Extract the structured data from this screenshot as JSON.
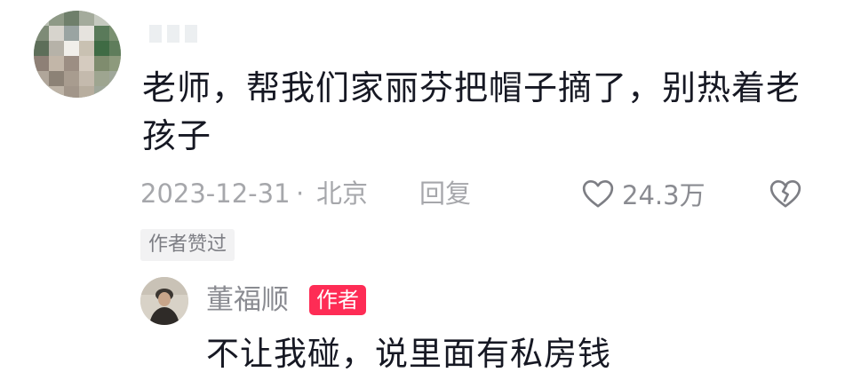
{
  "comment": {
    "text": "老师，帮我们家丽芬把帽子摘了，别热着老孩子",
    "date": "2023-12-31",
    "separator": "·",
    "location": "北京",
    "reply_label": "回复",
    "like_count": "24.3万",
    "author_liked_label": "作者赞过"
  },
  "reply": {
    "username": "董福顺",
    "badge": "作者",
    "text": "不让我碰，说里面有私房钱"
  },
  "colors": {
    "text_primary": "#161823",
    "text_secondary": "#a6a7ab",
    "author_badge": "#fe2c55"
  },
  "icons": {
    "like": "heart-outline-icon",
    "dislike": "broken-heart-icon"
  }
}
